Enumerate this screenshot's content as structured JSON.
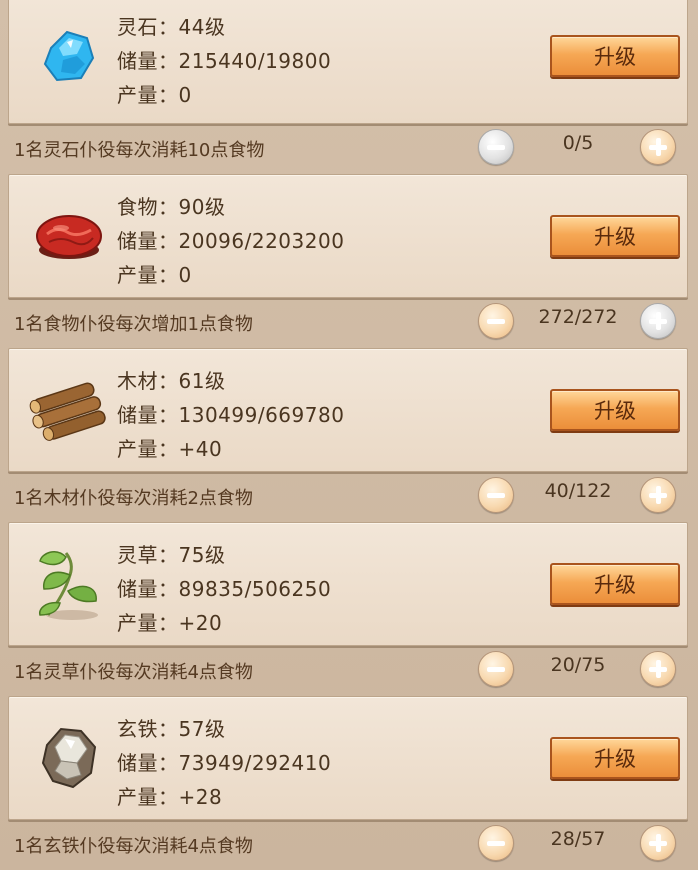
{
  "resources": [
    {
      "icon": "spirit-stone-icon",
      "name": "灵石：44级",
      "stock": "储量：215440/19800",
      "output": "产量：0",
      "upgrade_label": "升级",
      "worker_text": "1名灵石仆役每次消耗10点食物",
      "worker_count": "0/5",
      "minus_enabled": false,
      "plus_enabled": true
    },
    {
      "icon": "meat-icon",
      "name": "食物：90级",
      "stock": "储量：20096/2203200",
      "output": "产量：0",
      "upgrade_label": "升级",
      "worker_text": "1名食物仆役每次增加1点食物",
      "worker_count": "272/272",
      "minus_enabled": true,
      "plus_enabled": false
    },
    {
      "icon": "wood-logs-icon",
      "name": "木材：61级",
      "stock": "储量：130499/669780",
      "output": "产量：+40",
      "upgrade_label": "升级",
      "worker_text": "1名木材仆役每次消耗2点食物",
      "worker_count": "40/122",
      "minus_enabled": true,
      "plus_enabled": true
    },
    {
      "icon": "herb-icon",
      "name": "灵草：75级",
      "stock": "储量：89835/506250",
      "output": "产量：+20",
      "upgrade_label": "升级",
      "worker_text": "1名灵草仆役每次消耗4点食物",
      "worker_count": "20/75",
      "minus_enabled": true,
      "plus_enabled": true
    },
    {
      "icon": "iron-ore-icon",
      "name": "玄铁：57级",
      "stock": "储量：73949/292410",
      "output": "产量：+28",
      "upgrade_label": "升级",
      "worker_text": "1名玄铁仆役每次消耗4点食物",
      "worker_count": "28/57",
      "minus_enabled": true,
      "plus_enabled": true
    }
  ],
  "colors": {
    "button_orange": "#f6a855",
    "text_brown": "#4a3520",
    "card_bg": "#f2e6d8"
  }
}
